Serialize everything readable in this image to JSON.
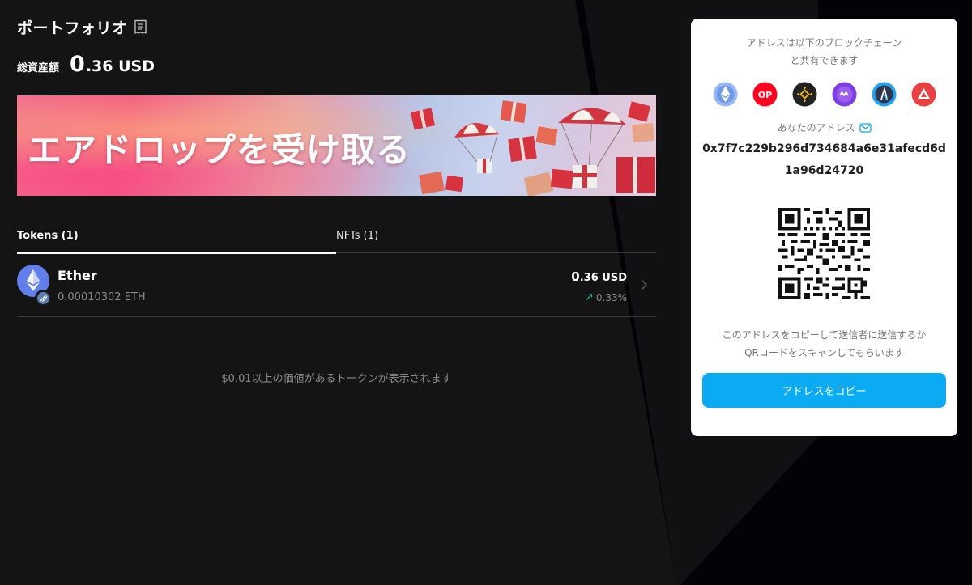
{
  "portfolio": {
    "title": "ポートフォリオ",
    "total_label": "総資産額",
    "total_int": "0",
    "total_rest": ".36 USD"
  },
  "banner": {
    "text": "エアドロップを受け取る"
  },
  "tabs": [
    {
      "label": "Tokens (1)",
      "active": true
    },
    {
      "label": "NFTs (1)",
      "active": false
    }
  ],
  "tokens": [
    {
      "name": "Ether",
      "amount": "0.00010302 ETH",
      "value_int": "0",
      "value_rest": ".36 USD",
      "change": "0.33%",
      "icon": "ethereum-icon",
      "badge_icon": "network-badge-icon"
    }
  ],
  "footer_note": "$0.01以上の価値があるトークンが表示されます",
  "receive_panel": {
    "share_note_line1": "アドレスは以下のブロックチェーン",
    "share_note_line2": "と共有できます",
    "chains": [
      "ethereum-icon",
      "optimism-icon",
      "bnb-chain-icon",
      "polygon-icon",
      "arbitrum-icon",
      "avalanche-icon"
    ],
    "address_label": "あなたのアドレス",
    "address": "0x7f7c229b296d734684a6e31afecd6d1a96d24720",
    "instruction_line1": "このアドレスをコピーして送信者に送信するか",
    "instruction_line2": "QRコードをスキャンしてもらいます",
    "copy_button": "アドレスをコピー"
  },
  "colors": {
    "accent": "#0aabf2",
    "positive": "#2bbf9f",
    "background": "#141414"
  }
}
